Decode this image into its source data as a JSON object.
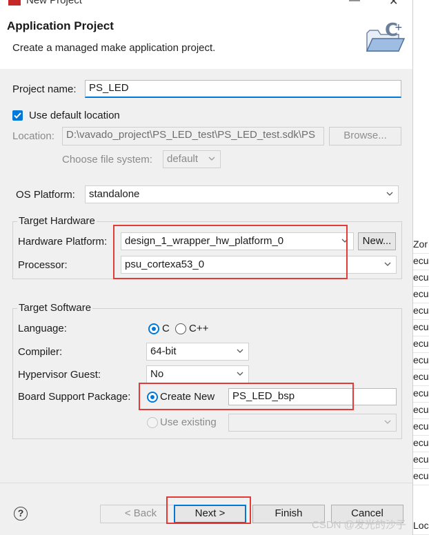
{
  "window": {
    "title": "New Project",
    "close_glyph": "✕"
  },
  "header": {
    "title": "Application Project",
    "description": "Create a managed make application project.",
    "icon": "new-c-project-folder-icon"
  },
  "form": {
    "project_name_label": "Project name:",
    "project_name_value": "PS_LED",
    "use_default_location_label": "Use default location",
    "use_default_location_checked": true,
    "location_label": "Location:",
    "location_value": "D:\\vavado_project\\PS_LED_test\\PS_LED_test.sdk\\PS",
    "browse_label": "Browse...",
    "file_system_label": "Choose file system:",
    "file_system_value": "default",
    "os_platform_label": "OS Platform:",
    "os_platform_value": "standalone"
  },
  "target_hardware": {
    "title": "Target Hardware",
    "hardware_platform_label": "Hardware Platform:",
    "hardware_platform_value": "design_1_wrapper_hw_platform_0",
    "new_label": "New...",
    "processor_label": "Processor:",
    "processor_value": "psu_cortexa53_0"
  },
  "target_software": {
    "title": "Target Software",
    "language_label": "Language:",
    "language_options": [
      "C",
      "C++"
    ],
    "language_selected": "C",
    "compiler_label": "Compiler:",
    "compiler_value": "64-bit",
    "hypervisor_label": "Hypervisor Guest:",
    "hypervisor_value": "No",
    "bsp_label": "Board Support Package:",
    "create_new_label": "Create New",
    "bsp_name_value": "PS_LED_bsp",
    "use_existing_label": "Use existing",
    "bsp_selected": "Create New"
  },
  "buttons": {
    "help": "?",
    "back": "< Back",
    "next": "Next >",
    "finish": "Finish",
    "cancel": "Cancel"
  },
  "background_lines": [
    "Zor",
    "ecu",
    "ecu",
    "ecu",
    "ecu",
    "ecu",
    "ecu",
    "ecu",
    "ecu",
    "ecu",
    "ecu",
    "ecu",
    "ecu",
    "ecu",
    "ecu",
    "Loc"
  ],
  "watermark": "CSDN @发光的沙子",
  "colors": {
    "accent": "#0078d7",
    "highlight_box": "#e53935",
    "dialog_bg": "#f0f0f0"
  }
}
